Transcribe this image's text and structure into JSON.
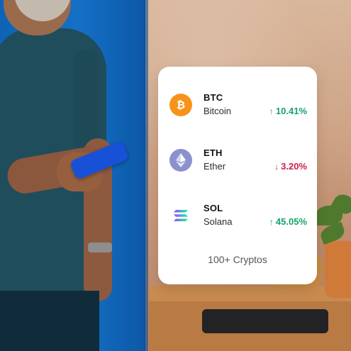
{
  "cryptos": [
    {
      "symbol": "BTC",
      "name": "Bitcoin",
      "change": "10.41%",
      "direction": "up",
      "arrow": "↑",
      "icon": "bitcoin-icon",
      "color": "#f7931a"
    },
    {
      "symbol": "ETH",
      "name": "Ether",
      "change": "3.20%",
      "direction": "down",
      "arrow": "↓",
      "icon": "ethereum-icon",
      "color": "#8a91cd"
    },
    {
      "symbol": "SOL",
      "name": "Solana",
      "change": "45.05%",
      "direction": "up",
      "arrow": "↑",
      "icon": "solana-icon",
      "color": "#9945ff"
    }
  ],
  "footer": "100+ Cryptos",
  "colors": {
    "up": "#16a36a",
    "down": "#d21d48",
    "card": "#ffffff"
  }
}
